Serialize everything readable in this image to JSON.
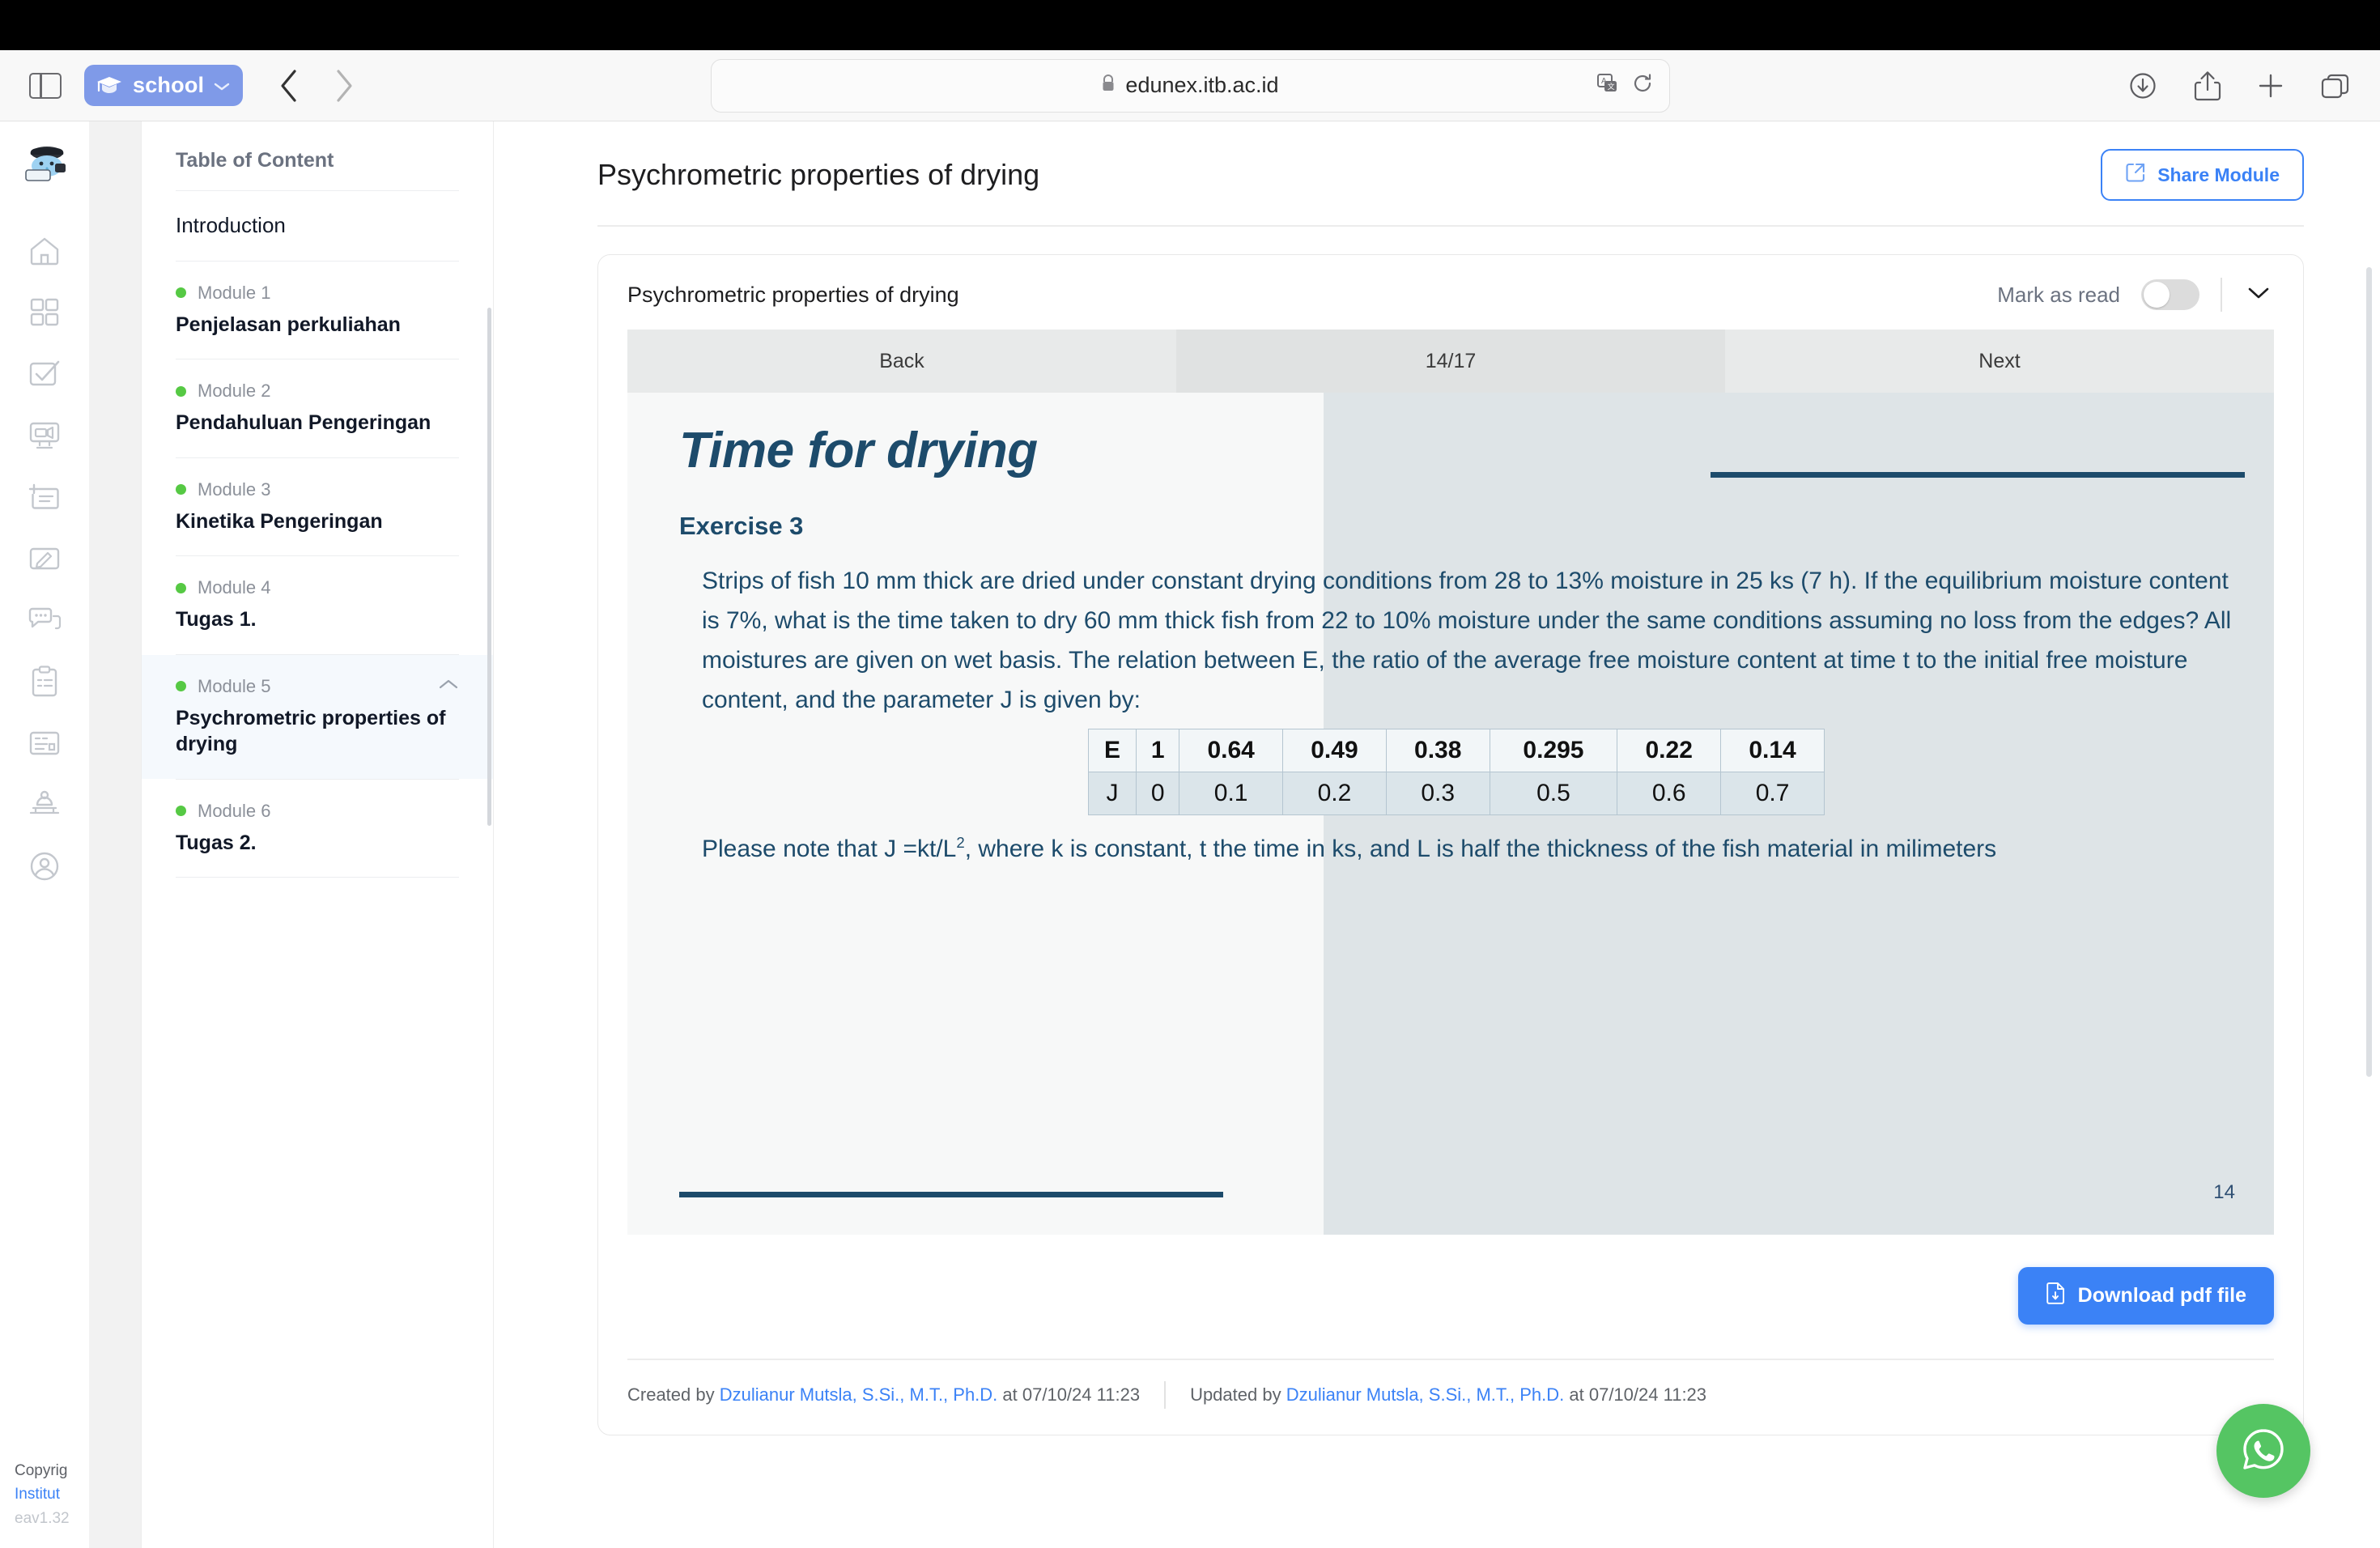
{
  "browser": {
    "profile_label": "school",
    "url": "edunex.itb.ac.id",
    "icons": {
      "sidebar_toggle": "sidebar-toggle-icon",
      "back": "chevron-left-icon",
      "forward": "chevron-right-icon",
      "lock": "lock-icon",
      "translate": "translate-icon",
      "reload": "reload-icon",
      "downloads": "download-circle-icon",
      "share": "share-icon",
      "new_tab": "plus-icon",
      "tabs": "tabs-overview-icon"
    }
  },
  "rail": {
    "logo": "elephant-mascot-logo",
    "items": [
      {
        "name": "home-icon"
      },
      {
        "name": "dashboard-grid-icon"
      },
      {
        "name": "task-check-icon"
      },
      {
        "name": "video-conference-icon"
      },
      {
        "name": "add-note-icon"
      },
      {
        "name": "pencil-edit-icon"
      },
      {
        "name": "chat-bubble-icon"
      },
      {
        "name": "clipboard-list-icon"
      },
      {
        "name": "form-card-icon"
      },
      {
        "name": "podium-teaching-icon"
      },
      {
        "name": "user-profile-icon"
      }
    ],
    "footer": {
      "copyright": "Copyrig",
      "institution": "Institut",
      "version": "eav1.32"
    }
  },
  "toc": {
    "title": "Table of Content",
    "items": [
      {
        "module": "",
        "name": "Introduction",
        "active": false
      },
      {
        "module": "Module 1",
        "name": "Penjelasan perkuliahan",
        "active": false
      },
      {
        "module": "Module 2",
        "name": "Pendahuluan Pengeringan",
        "active": false
      },
      {
        "module": "Module 3",
        "name": "Kinetika Pengeringan",
        "active": false
      },
      {
        "module": "Module 4",
        "name": "Tugas 1.",
        "active": false
      },
      {
        "module": "Module 5",
        "name": "Psychrometric properties of drying",
        "active": true
      },
      {
        "module": "Module 6",
        "name": "Tugas 2.",
        "active": false
      }
    ]
  },
  "main": {
    "page_title": "Psychrometric properties of drying",
    "share_button": "Share Module",
    "module_card": {
      "title": "Psychrometric properties of drying",
      "mark_as_read_label": "Mark as read",
      "mark_as_read_state": "off"
    },
    "slide_nav": {
      "back": "Back",
      "counter": "14/17",
      "next": "Next"
    },
    "slide": {
      "title": "Time for drying",
      "exercise": "Exercise 3",
      "paragraph_1": "Strips of fish 10 mm thick are dried under constant drying conditions from 28 to 13% moisture in 25 ks (7 h). If the equilibrium moisture content is 7%, what is the time taken to dry 60 mm thick fish from 22 to 10% moisture under the same conditions assuming no loss from the edges? All moistures are given on wet basis. The relation between E, the ratio of the average free moisture content at time t to the initial free moisture content, and the parameter J is given by:",
      "paragraph_2_pre": "Please note that J =kt/L",
      "paragraph_2_sup": "2",
      "paragraph_2_post": ", where k is constant, t the time in ks, and L is half the thickness of the fish material in milimeters",
      "page_number": "14",
      "table": {
        "rows": [
          {
            "label": "E",
            "values": [
              "1",
              "0.64",
              "0.49",
              "0.38",
              "0.295",
              "0.22",
              "0.14"
            ]
          },
          {
            "label": "J",
            "values": [
              "0",
              "0.1",
              "0.2",
              "0.3",
              "0.5",
              "0.6",
              "0.7"
            ]
          }
        ]
      },
      "colors": {
        "text": "#1d4b6b",
        "left_bg": "#f7f8f8",
        "right_bg": "#dee4e7"
      }
    },
    "download_button": "Download pdf file",
    "meta": {
      "created_prefix": "Created by",
      "created_author": "Dzulianur Mutsla, S.Si., M.T., Ph.D.",
      "created_suffix": "at 07/10/24 11:23",
      "updated_prefix": "Updated by",
      "updated_author": "Dzulianur Mutsla, S.Si., M.T., Ph.D.",
      "updated_suffix": "at 07/10/24 11:23"
    }
  },
  "fab": {
    "name": "whatsapp-icon",
    "color": "#55c563"
  }
}
